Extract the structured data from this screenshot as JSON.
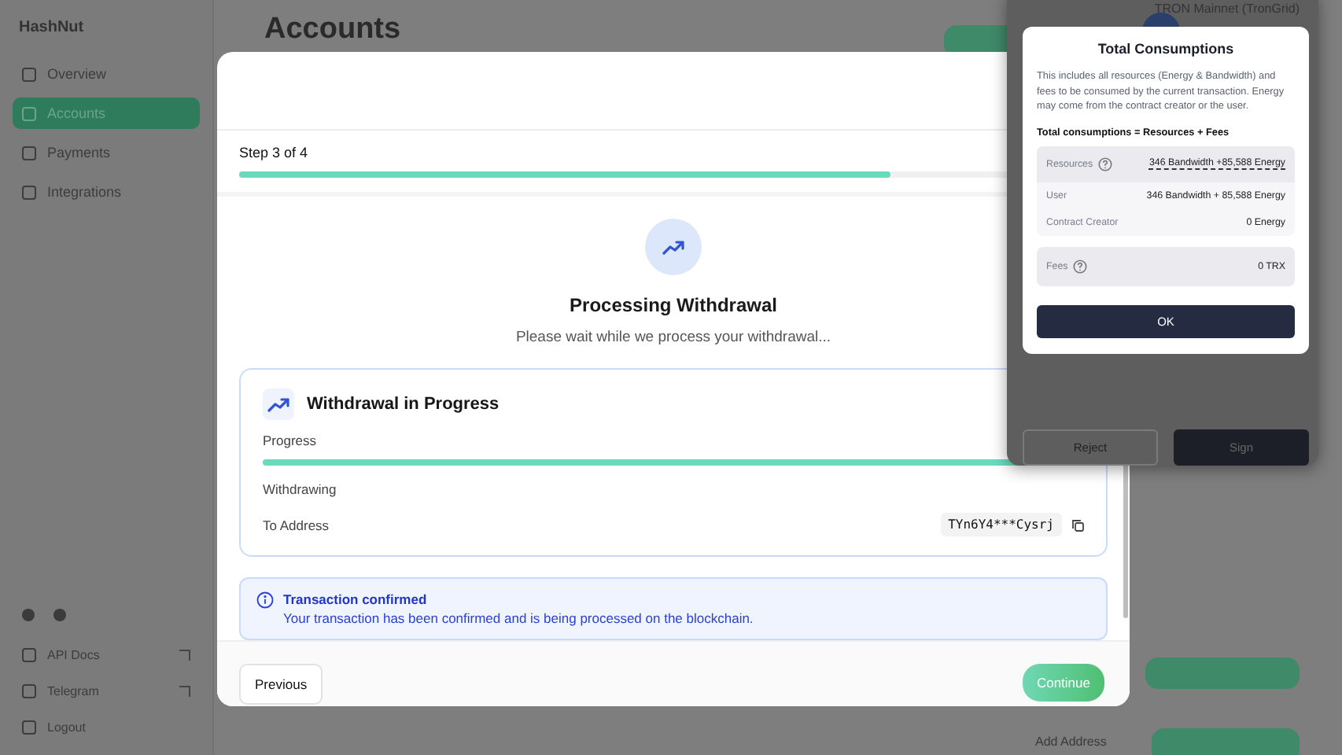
{
  "sidebar": {
    "brand": "HashNut",
    "nav": [
      {
        "label": "Overview",
        "selected": false
      },
      {
        "label": "Accounts",
        "selected": true
      },
      {
        "label": "Payments",
        "selected": false
      },
      {
        "label": "Integrations",
        "selected": false
      }
    ],
    "footer_nav": [
      {
        "label": "API Docs",
        "external": true
      },
      {
        "label": "Telegram",
        "external": true
      },
      {
        "label": "Logout",
        "external": false
      }
    ]
  },
  "page": {
    "title": "Accounts",
    "add_link": "Add Address"
  },
  "modal": {
    "step": {
      "label": "Step 3 of 4",
      "level": 0.75
    },
    "heading": "Processing Withdrawal",
    "subtitle": "Please wait while we process your withdrawal...",
    "card": {
      "title": "Withdrawal in Progress",
      "progress_label": "Progress",
      "level": 0.95,
      "rows": [
        {
          "label": "Withdrawing"
        },
        {
          "label": "To Address",
          "value": "TYn6Y4***Cysrj"
        }
      ]
    },
    "alert": {
      "title": "Transaction confirmed",
      "message": "Your transaction has been confirmed and is being processed on the blockchain."
    },
    "previous": "Previous",
    "continue": "Continue"
  },
  "wallet": {
    "network": "TRON Mainnet (TronGrid)",
    "dialog": {
      "title": "Total Consumptions",
      "description": "This includes all resources (Energy & Bandwidth) and fees to be consumed by the current transaction. Energy may come from the contract creator or the user.",
      "formula": "Total consumptions = Resources + Fees",
      "resources": {
        "label": "Resources",
        "value": "346 Bandwidth +85,588 Energy"
      },
      "details": [
        {
          "label": "User",
          "value": "346 Bandwidth + 85,588 Energy"
        },
        {
          "label": "Contract Creator",
          "value": "0 Energy"
        }
      ],
      "fees": {
        "label": "Fees",
        "value": "0 TRX"
      },
      "ok": "OK"
    },
    "reject": "Reject",
    "sign": "Sign"
  }
}
